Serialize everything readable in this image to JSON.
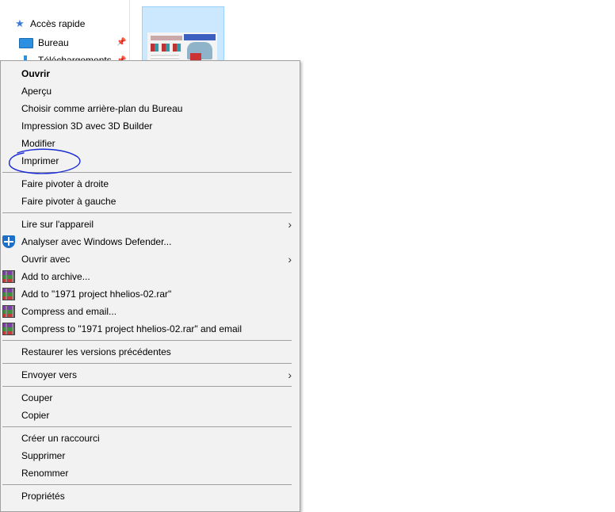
{
  "nav": {
    "quick_access": "Accès rapide",
    "desktop": "Bureau",
    "downloads": "Téléchargements"
  },
  "menu": {
    "items": [
      {
        "label": "Ouvrir"
      },
      {
        "label": "Aperçu"
      },
      {
        "label": "Choisir comme arrière-plan du Bureau"
      },
      {
        "label": "Impression 3D avec 3D Builder"
      },
      {
        "label": "Modifier"
      },
      {
        "label": "Imprimer"
      },
      {
        "label": "Faire pivoter à droite"
      },
      {
        "label": "Faire pivoter à gauche"
      },
      {
        "label": "Lire sur l'appareil"
      },
      {
        "label": "Analyser avec Windows Defender..."
      },
      {
        "label": "Ouvrir avec"
      },
      {
        "label": "Add to archive..."
      },
      {
        "label": "Add to \"1971 project hhelios-02.rar\""
      },
      {
        "label": "Compress and email..."
      },
      {
        "label": "Compress to \"1971 project hhelios-02.rar\" and email"
      },
      {
        "label": "Restaurer les versions précédentes"
      },
      {
        "label": "Envoyer vers"
      },
      {
        "label": "Couper"
      },
      {
        "label": "Copier"
      },
      {
        "label": "Créer un raccourci"
      },
      {
        "label": "Supprimer"
      },
      {
        "label": "Renommer"
      },
      {
        "label": "Propriétés"
      }
    ],
    "submenu_arrow": "›"
  },
  "colors": {
    "menu_bg": "#f2f2f2",
    "separator": "#a0a0a0",
    "selection_bg": "#cce8ff",
    "annotation": "#1a2bd6"
  },
  "icons": {
    "quick_access": "star-icon",
    "desktop": "desktop-icon",
    "downloads": "download-icon",
    "pin": "pin-icon",
    "defender": "windows-defender-icon",
    "winrar": "winrar-icon"
  }
}
